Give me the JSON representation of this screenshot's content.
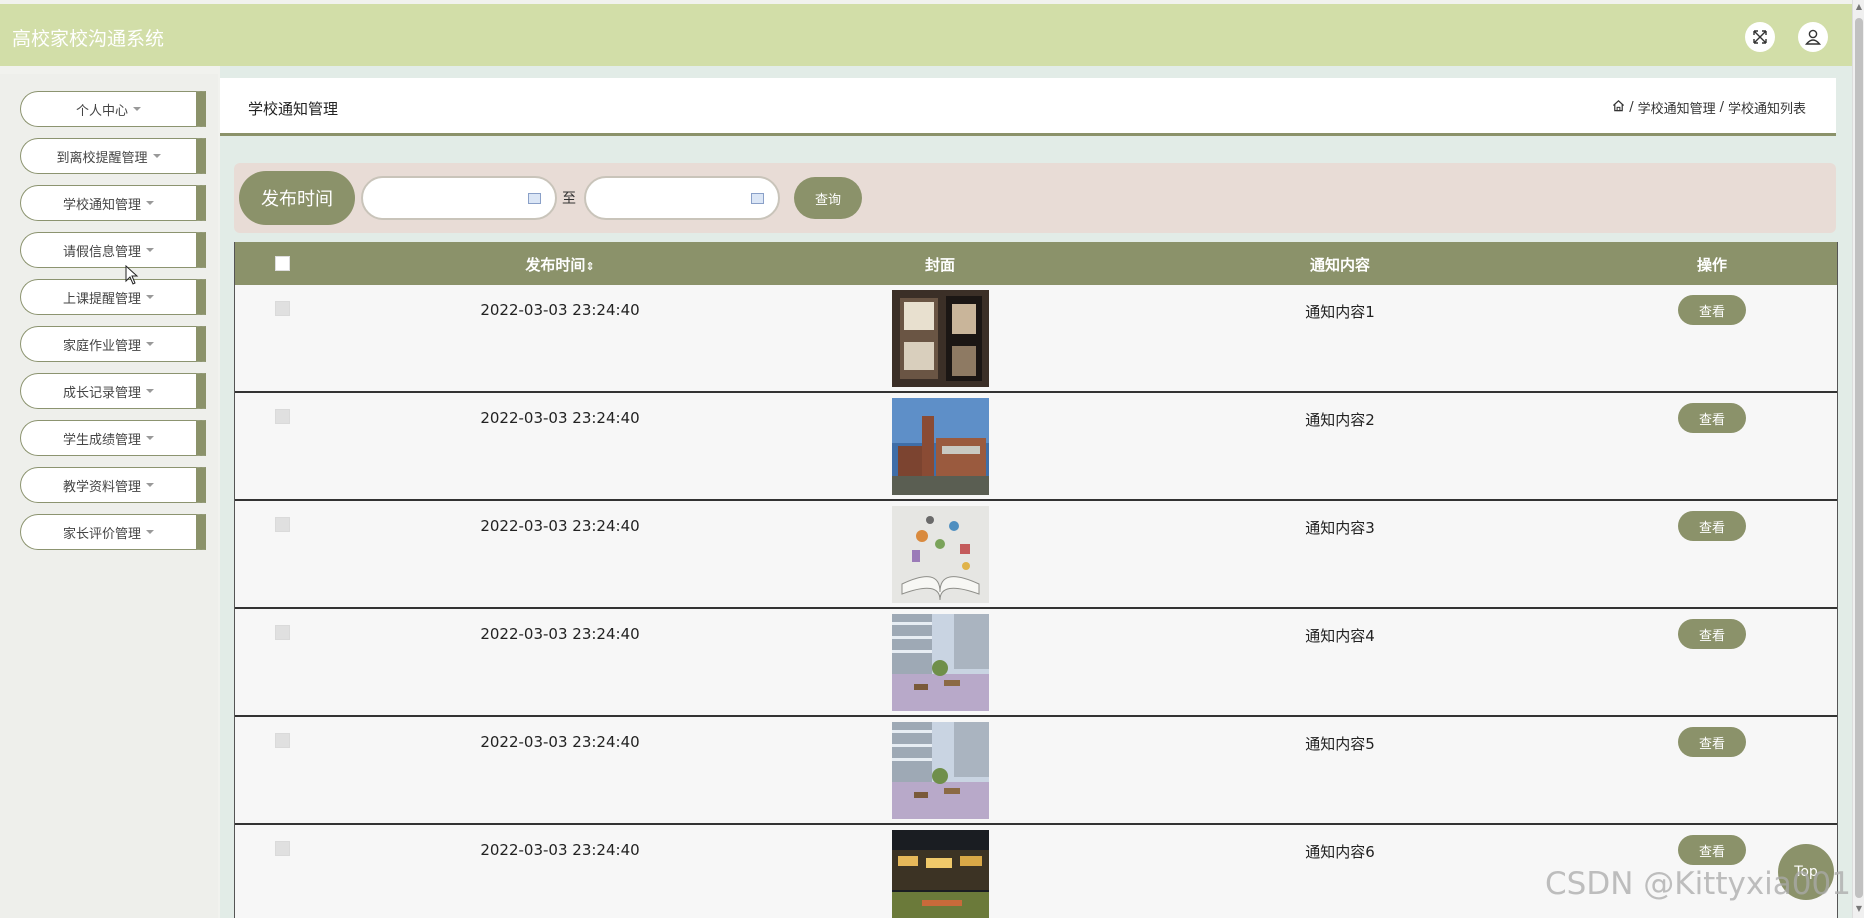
{
  "app": {
    "title": "高校家校沟通系统"
  },
  "topbar": {
    "icons": [
      "fullscreen-icon",
      "user-icon"
    ]
  },
  "sidebar": {
    "items": [
      {
        "label": "个人中心"
      },
      {
        "label": "到离校提醒管理"
      },
      {
        "label": "学校通知管理"
      },
      {
        "label": "请假信息管理"
      },
      {
        "label": "上课提醒管理"
      },
      {
        "label": "家庭作业管理"
      },
      {
        "label": "成长记录管理"
      },
      {
        "label": "学生成绩管理"
      },
      {
        "label": "教学资料管理"
      },
      {
        "label": "家长评价管理"
      }
    ]
  },
  "page": {
    "title": "学校通知管理",
    "breadcrumb": [
      "学校通知管理",
      "学校通知列表"
    ],
    "breadcrumb_separator": "/"
  },
  "search": {
    "label": "发布时间",
    "start_value": "",
    "end_value": "",
    "to_text": "至",
    "query_label": "查询"
  },
  "table": {
    "headers": {
      "publish_time": "发布时间",
      "sort_icon": "⇕",
      "cover": "封面",
      "content": "通知内容",
      "action": "操作"
    },
    "rows": [
      {
        "publish_time": "2022-03-03 23:24:40",
        "cover": "dormitory-bunk-bed-photo",
        "content": "通知内容1",
        "action": "查看"
      },
      {
        "publish_time": "2022-03-03 23:24:40",
        "cover": "brick-school-building-photo",
        "content": "通知内容2",
        "action": "查看"
      },
      {
        "publish_time": "2022-03-03 23:24:40",
        "cover": "open-book-icons-photo",
        "content": "通知内容3",
        "action": "查看"
      },
      {
        "publish_time": "2022-03-03 23:24:40",
        "cover": "campus-courtyard-photo",
        "content": "通知内容4",
        "action": "查看"
      },
      {
        "publish_time": "2022-03-03 23:24:40",
        "cover": "campus-courtyard-photo",
        "content": "通知内容5",
        "action": "查看"
      },
      {
        "publish_time": "2022-03-03 23:24:40",
        "cover": "campus-night-photo",
        "content": "通知内容6",
        "action": "查看"
      }
    ]
  },
  "back_to_top": "Top",
  "watermark": "CSDN @Kittyxia001",
  "colors": {
    "accent": "#8b926a",
    "topbar": "#d2dea8",
    "search_bg": "#e8dcd6"
  }
}
